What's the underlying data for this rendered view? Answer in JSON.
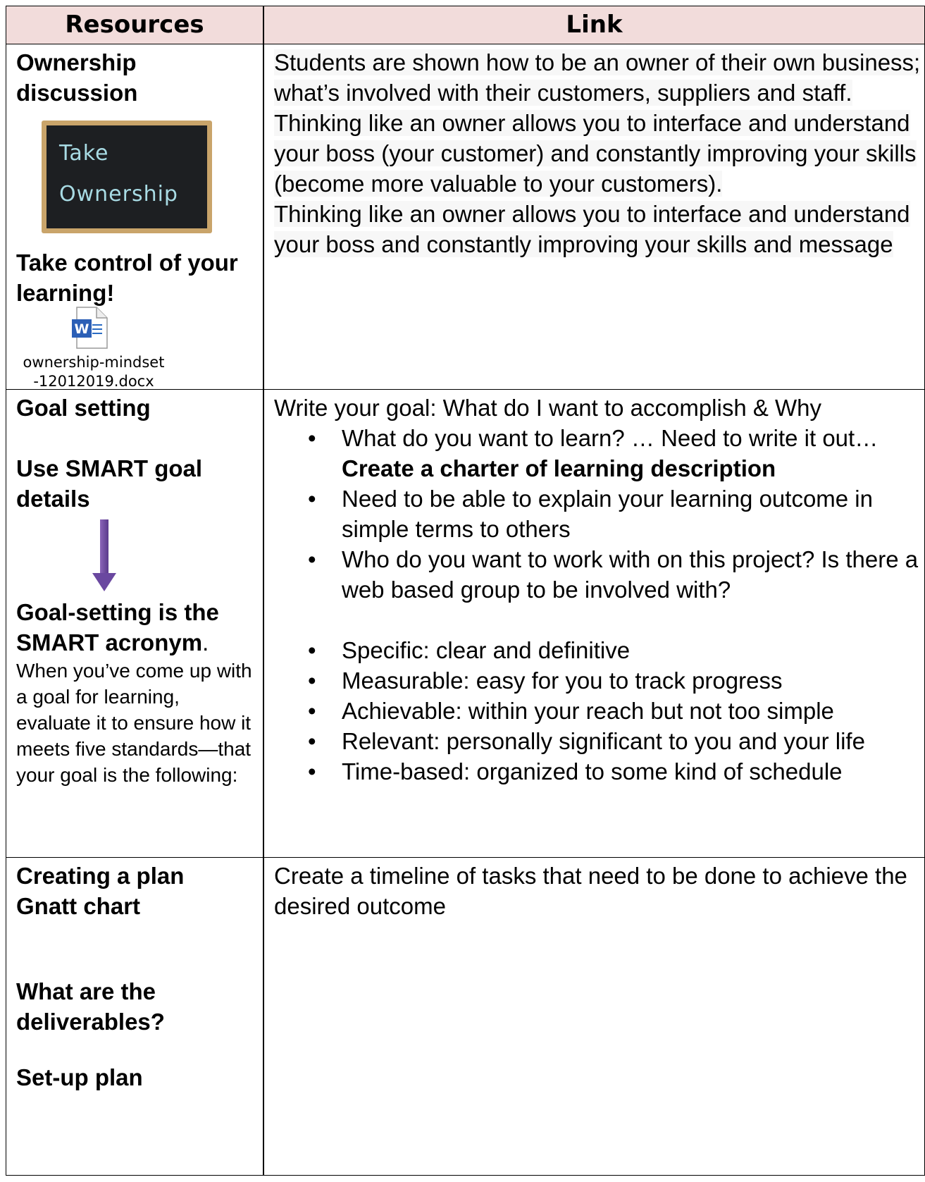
{
  "header": {
    "resources": "Resources",
    "link": "Link"
  },
  "row1": {
    "title": "Ownership discussion",
    "image_text": [
      "Take",
      "Ownership"
    ],
    "subtitle": "Take control of your learning!",
    "attachment_icon": "word-doc-icon",
    "attachment_name_line1": "ownership-mindset",
    "attachment_name_line2": "-12012019.docx",
    "link_paragraph1": "Students are shown how to be an owner of their own business; what’s involved with their customers, suppliers and staff. Thinking like an owner allows you to interface and understand your boss (your customer) and constantly improving your skills (become more valuable to your customers).",
    "link_paragraph2": "Thinking like an owner allows you to interface and understand your boss and constantly improving your skills and message"
  },
  "row2": {
    "title": "Goal setting",
    "subtitle": "Use SMART goal details",
    "arrow_icon": "down-arrow-icon",
    "heading": "Goal-setting is the SMART acronym",
    "heading_period": ".",
    "description": "When you’ve come up with a goal for learning, evaluate it to ensure how it meets five standards—that your goal is the following:",
    "intro": "Write your goal:  What do I want to accomplish & Why",
    "bullet1_text": "What do you want to learn? … Need to write it out… ",
    "bullet1_bold": "Create a charter of learning description",
    "bullet2": "Need to be able to explain your learning outcome in simple terms to others",
    "bullet3": "Who do you want to work with on this project?  Is there a web based group to be involved with?",
    "smart": [
      "Specific: clear and definitive",
      "Measurable: easy for you to track progress",
      "Achievable: within your reach but not too simple",
      "Relevant: personally significant to you and your life",
      "Time-based: organized to some kind of schedule"
    ]
  },
  "row3": {
    "title_line1": "Creating a plan",
    "title_line2": "Gnatt chart",
    "question": "What are the deliverables?",
    "setup": "Set-up plan",
    "link_text": "Create a timeline of tasks that need to be done to achieve the desired outcome"
  }
}
